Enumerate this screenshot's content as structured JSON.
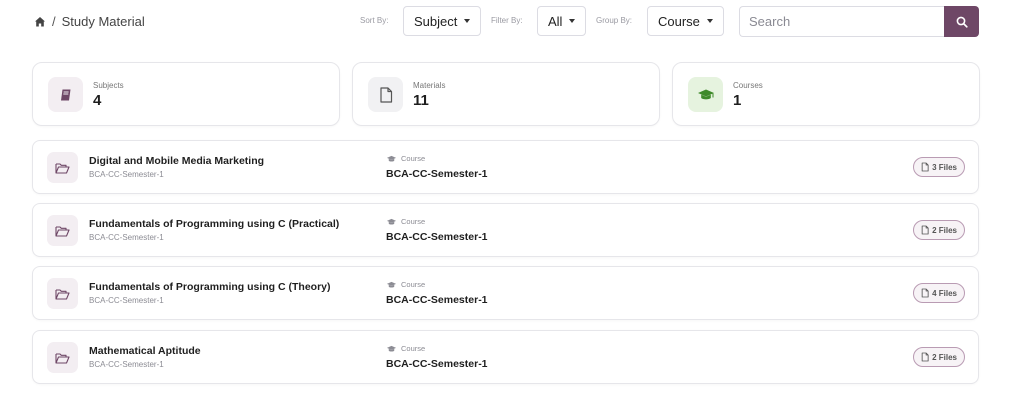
{
  "breadcrumb": {
    "separator": "/",
    "current": "Study Material"
  },
  "controls": {
    "sort_label": "Sort By:",
    "sort_value": "Subject",
    "filter_label": "Filter By:",
    "filter_value": "All",
    "group_label": "Group By:",
    "group_value": "Course",
    "search_placeholder": "Search"
  },
  "stats": [
    {
      "label": "Subjects",
      "value": "4",
      "icon": "book-icon"
    },
    {
      "label": "Materials",
      "value": "11",
      "icon": "file-icon"
    },
    {
      "label": "Courses",
      "value": "1",
      "icon": "graduation-cap-icon"
    }
  ],
  "course_label": "Course",
  "rows": [
    {
      "title": "Digital and Mobile Media Marketing",
      "subtitle": "BCA-CC-Semester-1",
      "course": "BCA-CC-Semester-1",
      "files": "3 Files"
    },
    {
      "title": "Fundamentals of Programming using C (Practical)",
      "subtitle": "BCA-CC-Semester-1",
      "course": "BCA-CC-Semester-1",
      "files": "2 Files"
    },
    {
      "title": "Fundamentals of Programming using C (Theory)",
      "subtitle": "BCA-CC-Semester-1",
      "course": "BCA-CC-Semester-1",
      "files": "4 Files"
    },
    {
      "title": "Mathematical Aptitude",
      "subtitle": "BCA-CC-Semester-1",
      "course": "BCA-CC-Semester-1",
      "files": "2 Files"
    }
  ],
  "colors": {
    "accent": "#6e4766",
    "subject_icon_bg": "#f3eef2",
    "course_icon_bg": "#e6f3df",
    "course_icon": "#3f8a2a"
  }
}
